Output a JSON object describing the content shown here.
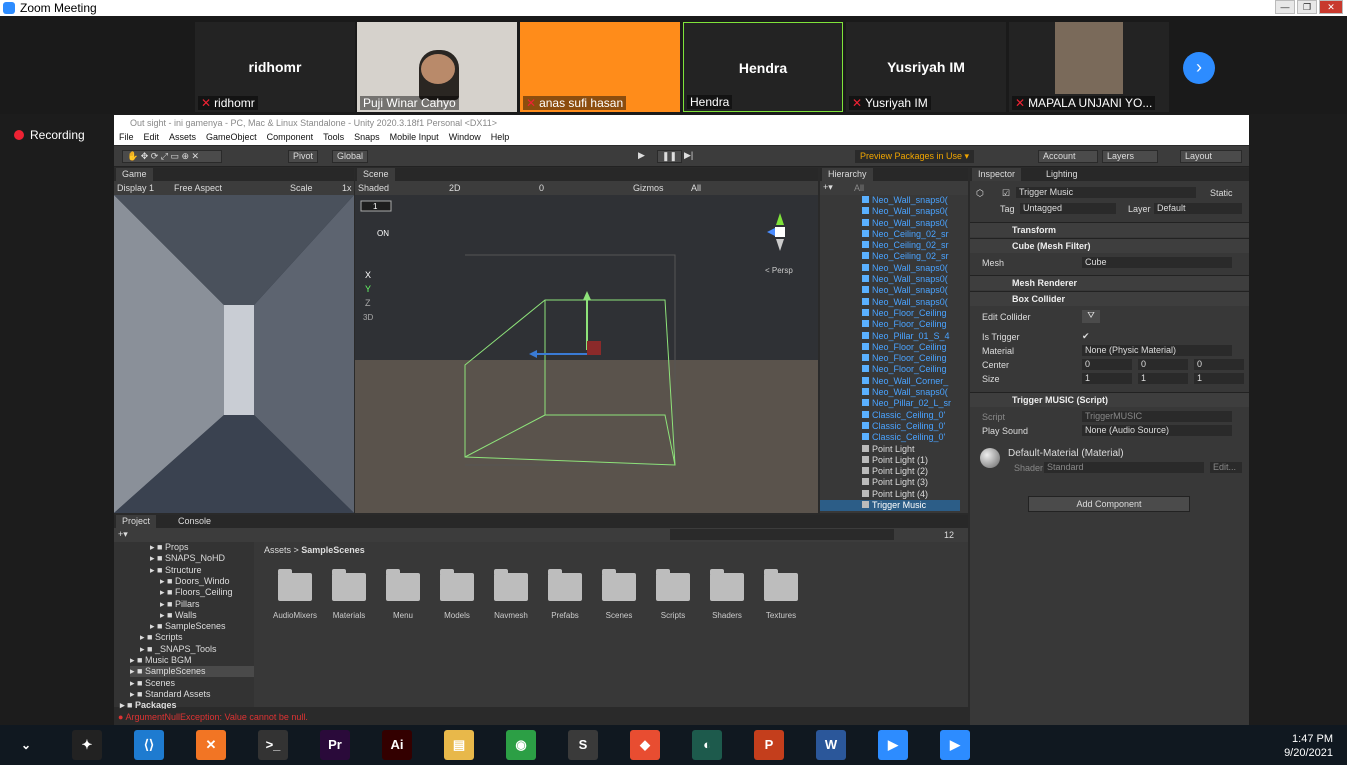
{
  "zoom": {
    "title": "Zoom Meeting",
    "window_buttons": [
      "—",
      "❐",
      "✕"
    ],
    "participants": [
      {
        "display": "ridhomr",
        "label": "ridhomr",
        "muted": true,
        "video": false
      },
      {
        "display": "",
        "label": "Puji Winar Cahyo",
        "muted": false,
        "video": true
      },
      {
        "display": "",
        "label": "anas sufi hasan",
        "muted": true,
        "video": false,
        "bg": "#ff8c1a"
      },
      {
        "display": "Hendra",
        "label": "Hendra",
        "muted": false,
        "video": false,
        "active": true
      },
      {
        "display": "Yusriyah IM",
        "label": "Yusriyah IM",
        "muted": true,
        "video": false
      },
      {
        "display": "",
        "label": "MAPALA UNJANI YO...",
        "muted": true,
        "video": true
      }
    ],
    "recording": "Recording",
    "next_icon": "chevron-right-icon"
  },
  "unity": {
    "title": "Out sight - ini gamenya - PC, Mac & Linux Standalone - Unity 2020.3.18f1 Personal <DX11>",
    "menu": [
      "File",
      "Edit",
      "Assets",
      "GameObject",
      "Component",
      "Tools",
      "Snaps",
      "Mobile Input",
      "Window",
      "Help"
    ],
    "toolbar": {
      "pivot": "Pivot",
      "global": "Global",
      "preview_packages": "Preview Packages in Use ▾",
      "account": "Account",
      "layers": "Layers",
      "layout": "Layout"
    },
    "game": {
      "tab": "Game",
      "display": "Display 1",
      "aspect": "Free Aspect",
      "scale_label": "Scale",
      "scale_value": "1x"
    },
    "scene": {
      "tab": "Scene",
      "shading": "Shaded",
      "mode_2d": "2D",
      "gizmos": "Gizmos",
      "search_placeholder": "All",
      "hidden_count": "0",
      "persp": "< Persp",
      "overlay_labels": [
        "1",
        "ON",
        "X",
        "Y",
        "Z",
        "3D"
      ]
    },
    "hierarchy": {
      "tab": "Hierarchy",
      "search_placeholder": "All",
      "items": [
        {
          "label": "Neo_Wall_snaps0(",
          "prefab": true
        },
        {
          "label": "Neo_Wall_snaps0(",
          "prefab": true
        },
        {
          "label": "Neo_Wall_snaps0(",
          "prefab": true
        },
        {
          "label": "Neo_Ceiling_02_sr",
          "prefab": true
        },
        {
          "label": "Neo_Ceiling_02_sr",
          "prefab": true
        },
        {
          "label": "Neo_Ceiling_02_sr",
          "prefab": true
        },
        {
          "label": "Neo_Wall_snaps0(",
          "prefab": true
        },
        {
          "label": "Neo_Wall_snaps0(",
          "prefab": true
        },
        {
          "label": "Neo_Wall_snaps0(",
          "prefab": true
        },
        {
          "label": "Neo_Wall_snaps0(",
          "prefab": true
        },
        {
          "label": "Neo_Floor_Ceiling",
          "prefab": true
        },
        {
          "label": "Neo_Floor_Ceiling",
          "prefab": true
        },
        {
          "label": "Neo_Pillar_01_S_4",
          "prefab": true
        },
        {
          "label": "Neo_Floor_Ceiling",
          "prefab": true
        },
        {
          "label": "Neo_Floor_Ceiling",
          "prefab": true
        },
        {
          "label": "Neo_Floor_Ceiling",
          "prefab": true
        },
        {
          "label": "Neo_Wall_Corner_",
          "prefab": true
        },
        {
          "label": "Neo_Wall_snaps0(",
          "prefab": true
        },
        {
          "label": "Neo_Pillar_02_L_sr",
          "prefab": true
        },
        {
          "label": "Classic_Ceiling_0'",
          "prefab": true
        },
        {
          "label": "Classic_Ceiling_0'",
          "prefab": true
        },
        {
          "label": "Classic_Ceiling_0'",
          "prefab": true
        },
        {
          "label": "Point Light",
          "prefab": false
        },
        {
          "label": "Point Light (1)",
          "prefab": false
        },
        {
          "label": "Point Light (2)",
          "prefab": false
        },
        {
          "label": "Point Light (3)",
          "prefab": false
        },
        {
          "label": "Point Light (4)",
          "prefab": false
        },
        {
          "label": "Trigger Music",
          "prefab": false,
          "selected": true
        }
      ]
    },
    "inspector": {
      "tab": "Inspector",
      "tab2": "Lighting",
      "object_name": "Trigger Music",
      "static": "Static",
      "tag_label": "Tag",
      "tag": "Untagged",
      "layer_label": "Layer",
      "layer": "Default",
      "transform": "Transform",
      "mesh_filter": "Cube (Mesh Filter)",
      "mesh_label": "Mesh",
      "mesh_value": "Cube",
      "mesh_renderer": "Mesh Renderer",
      "box_collider": "Box Collider",
      "edit_collider": "Edit Collider",
      "is_trigger": "Is Trigger",
      "material_label": "Material",
      "material_value": "None (Physic Material)",
      "center_label": "Center",
      "center": {
        "x": "0",
        "y": "0",
        "z": "0"
      },
      "size_label": "Size",
      "size": {
        "x": "1",
        "y": "1",
        "z": "1"
      },
      "script_comp": "Trigger MUSIC (Script)",
      "script_label": "Script",
      "script_value": "TriggerMUSIC",
      "play_sound_label": "Play Sound",
      "play_sound_value": "None (Audio Source)",
      "material_name": "Default-Material (Material)",
      "shader_label": "Shader",
      "shader_value": "Standard",
      "edit_btn": "Edit...",
      "add_component": "Add Component"
    },
    "project": {
      "tab": "Project",
      "tab2": "Console",
      "breadcrumb_root": "Assets",
      "breadcrumb_current": "SampleScenes",
      "count": "12",
      "tree": [
        {
          "label": "Props",
          "indent": 3
        },
        {
          "label": "SNAPS_NoHD",
          "indent": 3
        },
        {
          "label": "Structure",
          "indent": 3
        },
        {
          "label": "Doors_Windo",
          "indent": 4
        },
        {
          "label": "Floors_Ceiling",
          "indent": 4
        },
        {
          "label": "Pillars",
          "indent": 4
        },
        {
          "label": "Walls",
          "indent": 4
        },
        {
          "label": "SampleScenes",
          "indent": 3
        },
        {
          "label": "Scripts",
          "indent": 2
        },
        {
          "label": "_SNAPS_Tools",
          "indent": 2
        },
        {
          "label": "Music BGM",
          "indent": 1
        },
        {
          "label": "SampleScenes",
          "indent": 1,
          "selected": true
        },
        {
          "label": "Scenes",
          "indent": 1
        },
        {
          "label": "Standard Assets",
          "indent": 1
        },
        {
          "label": "Packages",
          "indent": 0,
          "bold": true
        }
      ],
      "folders": [
        "AudioMixers",
        "Materials",
        "Menu",
        "Models",
        "Navmesh",
        "Prefabs",
        "Scenes",
        "Scripts",
        "Shaders",
        "Textures"
      ]
    },
    "status_error": "ArgumentNullException: Value cannot be null."
  },
  "taskbar": {
    "apps": [
      "figma-icon",
      "vscode-icon",
      "xampp-icon",
      "terminal-icon",
      "premiere-icon",
      "illustrator-icon",
      "file-explorer-icon",
      "chrome-icon",
      "sublime-icon",
      "git-icon",
      "app-icon",
      "powerpoint-icon",
      "word-icon",
      "zoom-icon",
      "zoom-icon"
    ],
    "time": "1:47 PM",
    "date": "9/20/2021"
  }
}
